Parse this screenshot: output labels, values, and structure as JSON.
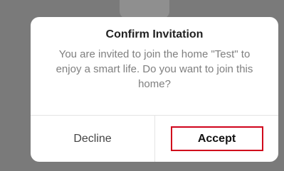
{
  "dialog": {
    "title": "Confirm Invitation",
    "message": "You are invited to join the home \"Test\" to enjoy a smart life. Do you want to join this home?",
    "decline_label": "Decline",
    "accept_label": "Accept"
  },
  "colors": {
    "backdrop": "#7a7a7a",
    "highlight_border": "#d0021b"
  }
}
